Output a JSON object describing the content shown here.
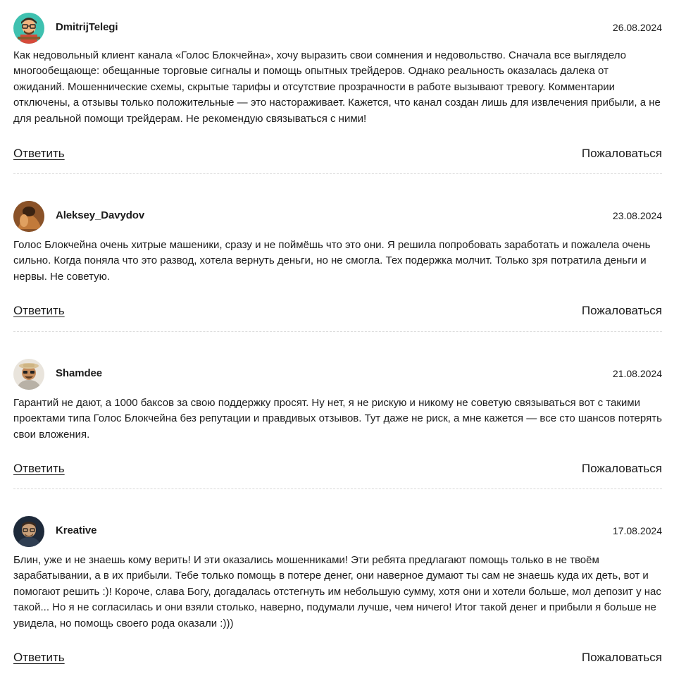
{
  "comments": [
    {
      "author": "DmitrijTelegi",
      "date": "26.08.2024",
      "avatar_icon": "cartoon-avatar-icon",
      "text": "Как недовольный клиент канала «Голос Блокчейна», хочу выразить свои сомнения и недовольство. Сначала все выглядело многообещающе: обещанные торговые сигналы и помощь опытных трейдеров. Однако реальность оказалась далека от ожиданий. Мошеннические схемы, скрытые тарифы и отсутствие прозрачности в работе вызывают тревогу. Комментарии отключены, а отзывы только положительные — это настораживает. Кажется, что канал создан лишь для извлечения прибыли, а не для реальной помощи трейдерам. Не рекомендую связываться с ними!",
      "reply_label": "Ответить",
      "report_label": "Пожаловаться"
    },
    {
      "author": "Aleksey_Davydov",
      "date": "23.08.2024",
      "avatar_icon": "photo-avatar-icon",
      "text": "Голос Блокчейна очень хитрые машеники, сразу и не поймёшь что это они. Я решила попробовать заработать и пожалела очень сильно. Когда поняла что это развод, хотела вернуть деньги, но не смогла. Тех подержка молчит. Только зря потратила деньги и нервы. Не советую.",
      "reply_label": "Ответить",
      "report_label": "Пожаловаться"
    },
    {
      "author": "Shamdee",
      "date": "21.08.2024",
      "avatar_icon": "photo-avatar-icon",
      "text": "Гарантий не дают, а 1000 баксов за свою поддержку просят. Ну нет, я не рискую и никому не советую связываться вот с такими проектами типа Голос Блокчейна без репутации и правдивых отзывов. Тут даже не риск, а мне кажется — все сто шансов потерять свои вложения.",
      "reply_label": "Ответить",
      "report_label": "Пожаловаться"
    },
    {
      "author": "Kreative",
      "date": "17.08.2024",
      "avatar_icon": "photo-avatar-icon",
      "text": "Блин, уже и не знаешь кому верить! И эти оказались мошенниками! Эти ребята предлагают помощь только в не твоём зарабатывании, а в их прибыли. Тебе только помощь в потере денег, они наверное думают ты сам не знаешь куда их деть, вот и помогают решить :)! Короче, слава Богу, догадалась отстегнуть им небольшую сумму, хотя они и хотели больше, мол депозит у нас такой... Но я не согласилась и они взяли столько, наверно, подумали лучше, чем ничего! Итог такой денег и прибыли я больше не увидела, но помощь своего рода оказали :)))",
      "reply_label": "Ответить",
      "report_label": "Пожаловаться"
    }
  ]
}
